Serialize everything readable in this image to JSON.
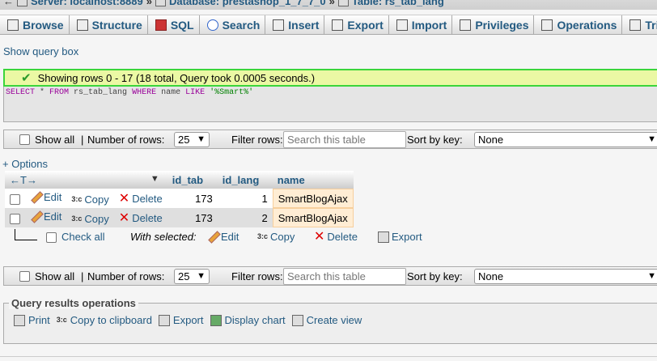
{
  "breadcrumb": {
    "server": "Server: localhost:8889",
    "database": "Database: prestashop_1_7_7_0",
    "table": "Table: rs_tab_lang",
    "separator": "»"
  },
  "tabs": [
    {
      "label": "Browse",
      "icon": "browse-icon"
    },
    {
      "label": "Structure",
      "icon": "structure-icon"
    },
    {
      "label": "SQL",
      "icon": "sql-icon"
    },
    {
      "label": "Search",
      "icon": "search-icon"
    },
    {
      "label": "Insert",
      "icon": "insert-icon"
    },
    {
      "label": "Export",
      "icon": "export-icon"
    },
    {
      "label": "Import",
      "icon": "import-icon"
    },
    {
      "label": "Privileges",
      "icon": "privileges-icon"
    },
    {
      "label": "Operations",
      "icon": "operations-icon"
    },
    {
      "label": "Trigge",
      "icon": "triggers-icon"
    }
  ],
  "show_query_box": "Show query box",
  "message": "Showing rows 0 - 17 (18 total, Query took 0.0005 seconds.)",
  "sql": {
    "select": "SELECT",
    "star": " * ",
    "from": "FROM",
    "table": " rs_tab_lang ",
    "where": "WHERE",
    "field": " name ",
    "like": "LIKE",
    "pattern": " '%Smart%'"
  },
  "nav": {
    "show_all": "Show all",
    "separator": "|",
    "num_rows_label": "Number of rows:",
    "num_rows_value": "25",
    "filter_label": "Filter rows:",
    "filter_placeholder": "Search this table",
    "sort_label": "Sort by key:",
    "sort_value": "None"
  },
  "options_link": "+ Options",
  "table": {
    "arrows": "←T→",
    "sort_arrow": "▼",
    "columns": [
      "id_tab",
      "id_lang",
      "name"
    ],
    "actions": {
      "edit": "Edit",
      "copy": "Copy",
      "delete": "Delete"
    },
    "rows": [
      {
        "id_tab": "173",
        "id_lang": "1",
        "name": "SmartBlogAjax"
      },
      {
        "id_tab": "173",
        "id_lang": "2",
        "name": "SmartBlogAjax"
      }
    ]
  },
  "with_selected": {
    "check_all": "Check all",
    "label": "With selected:",
    "edit": "Edit",
    "copy": "Copy",
    "delete": "Delete",
    "export": "Export"
  },
  "query_ops": {
    "title": "Query results operations",
    "print": "Print",
    "copy_clipboard": "Copy to clipboard",
    "export": "Export",
    "display_chart": "Display chart",
    "create_view": "Create view"
  },
  "colors": {
    "link": "#235a81",
    "success_bg": "#ebf8a4",
    "success_border": "#3bd53b",
    "delete_x": "#dd0000"
  }
}
